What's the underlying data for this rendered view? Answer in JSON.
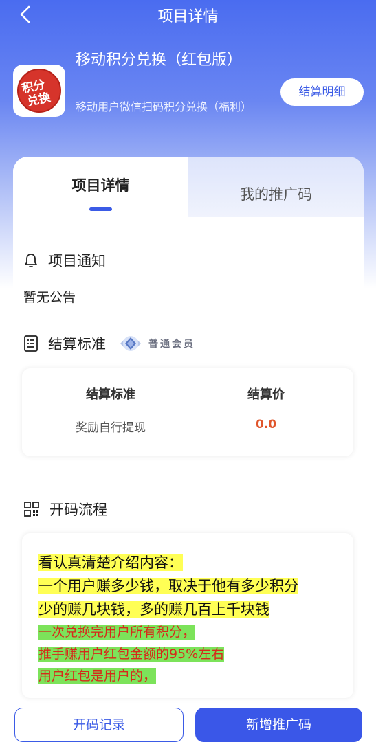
{
  "header": {
    "title": "项目详情",
    "back_icon": "chevron-left-icon"
  },
  "project": {
    "name": "移动积分兑换（红包版）",
    "subtitle": "移动用户微信扫码积分兑换（福利）",
    "logo_text": [
      "积分",
      "兑换"
    ],
    "settle_button": "结算明细"
  },
  "tabs": [
    {
      "label": "项目详情",
      "active": true
    },
    {
      "label": "我的推广码",
      "active": false
    }
  ],
  "notice": {
    "icon": "bell-icon",
    "title": "项目通知",
    "body": "暂无公告"
  },
  "settlement": {
    "icon": "document-list-icon",
    "title": "结算标准",
    "member_badge": "普通会员",
    "columns": [
      "结算标准",
      "结算价"
    ],
    "rows": [
      {
        "standard": "奖励自行提现",
        "price": "0.0"
      }
    ]
  },
  "flow": {
    "icon": "qr-code-icon",
    "title": "开码流程",
    "yellow_lines": [
      "看认真清楚介绍内容：",
      "一个用户赚多少钱，取决于他有多少积分",
      "少的赚几块钱，多的赚几百上千块钱"
    ],
    "green_lines": [
      "一次兑换完用户所有积分，",
      "推手赚用户红包金额的95%左右",
      "用户红包是用户的，"
    ]
  },
  "footer": {
    "records_button": "开码记录",
    "add_button": "新增推广码"
  },
  "colors": {
    "primary": "#3a57e8",
    "price": "#e0552b",
    "highlight_yellow": "#ffff55",
    "highlight_green": "#7ce35a"
  }
}
